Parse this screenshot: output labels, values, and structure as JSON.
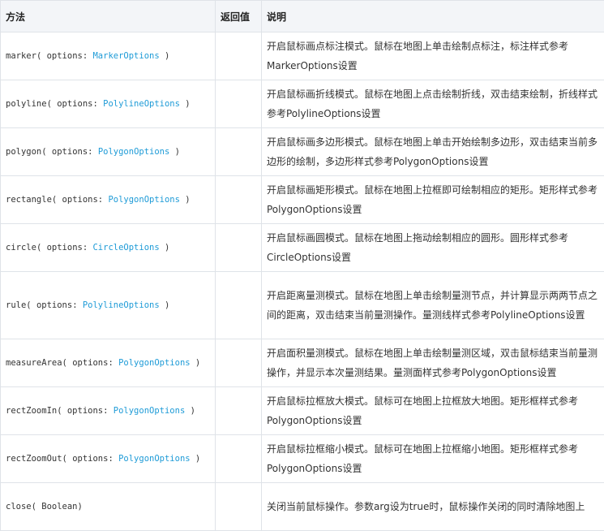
{
  "header": {
    "method": "方法",
    "return": "返回值",
    "description": "说明"
  },
  "rows": [
    {
      "name": "marker",
      "open": "( options: ",
      "type": "MarkerOptions",
      "close": " )",
      "return": "",
      "description": "开启鼠标画点标注模式。鼠标在地图上单击绘制点标注，标注样式参考MarkerOptions设置"
    },
    {
      "name": "polyline",
      "open": "( options: ",
      "type": "PolylineOptions",
      "close": " )",
      "return": "",
      "description": "开启鼠标画折线模式。鼠标在地图上点击绘制折线，双击结束绘制，折线样式参考PolylineOptions设置"
    },
    {
      "name": "polygon",
      "open": "( options: ",
      "type": "PolygonOptions",
      "close": " )",
      "return": "",
      "description": "开启鼠标画多边形模式。鼠标在地图上单击开始绘制多边形，双击结束当前多边形的绘制，多边形样式参考PolygonOptions设置"
    },
    {
      "name": "rectangle",
      "open": "( options: ",
      "type": "PolygonOptions",
      "close": " )",
      "return": "",
      "description": "开启鼠标画矩形模式。鼠标在地图上拉框即可绘制相应的矩形。矩形样式参考PolygonOptions设置"
    },
    {
      "name": "circle",
      "open": "( options: ",
      "type": "CircleOptions",
      "close": " )",
      "return": "",
      "description": "开启鼠标画圆模式。鼠标在地图上拖动绘制相应的圆形。圆形样式参考CircleOptions设置"
    },
    {
      "name": "rule",
      "open": "( options: ",
      "type": "PolylineOptions",
      "close": " )",
      "return": "",
      "description": "开启距离量测模式。鼠标在地图上单击绘制量测节点，并计算显示两两节点之间的距离，双击结束当前量测操作。量测线样式参考PolylineOptions设置"
    },
    {
      "name": "measureArea",
      "open": "( options: ",
      "type": "PolygonOptions",
      "close": " )",
      "return": "",
      "description": "开启面积量测模式。鼠标在地图上单击绘制量测区域，双击鼠标结束当前量测操作，并显示本次量测结果。量测面样式参考PolygonOptions设置"
    },
    {
      "name": "rectZoomIn",
      "open": "( options: ",
      "type": "PolygonOptions",
      "close": " )",
      "return": "",
      "description": "开启鼠标拉框放大模式。鼠标可在地图上拉框放大地图。矩形框样式参考PolygonOptions设置"
    },
    {
      "name": "rectZoomOut",
      "open": "( options: ",
      "type": "PolygonOptions",
      "close": " )",
      "return": "",
      "description": "开启鼠标拉框缩小模式。鼠标可在地图上拉框缩小地图。矩形框样式参考PolygonOptions设置"
    },
    {
      "name": "close",
      "open": "( Boolean)",
      "type": "",
      "close": "",
      "return": "",
      "description": "关闭当前鼠标操作。参数arg设为true时，鼠标操作关闭的同时清除地图上"
    }
  ]
}
